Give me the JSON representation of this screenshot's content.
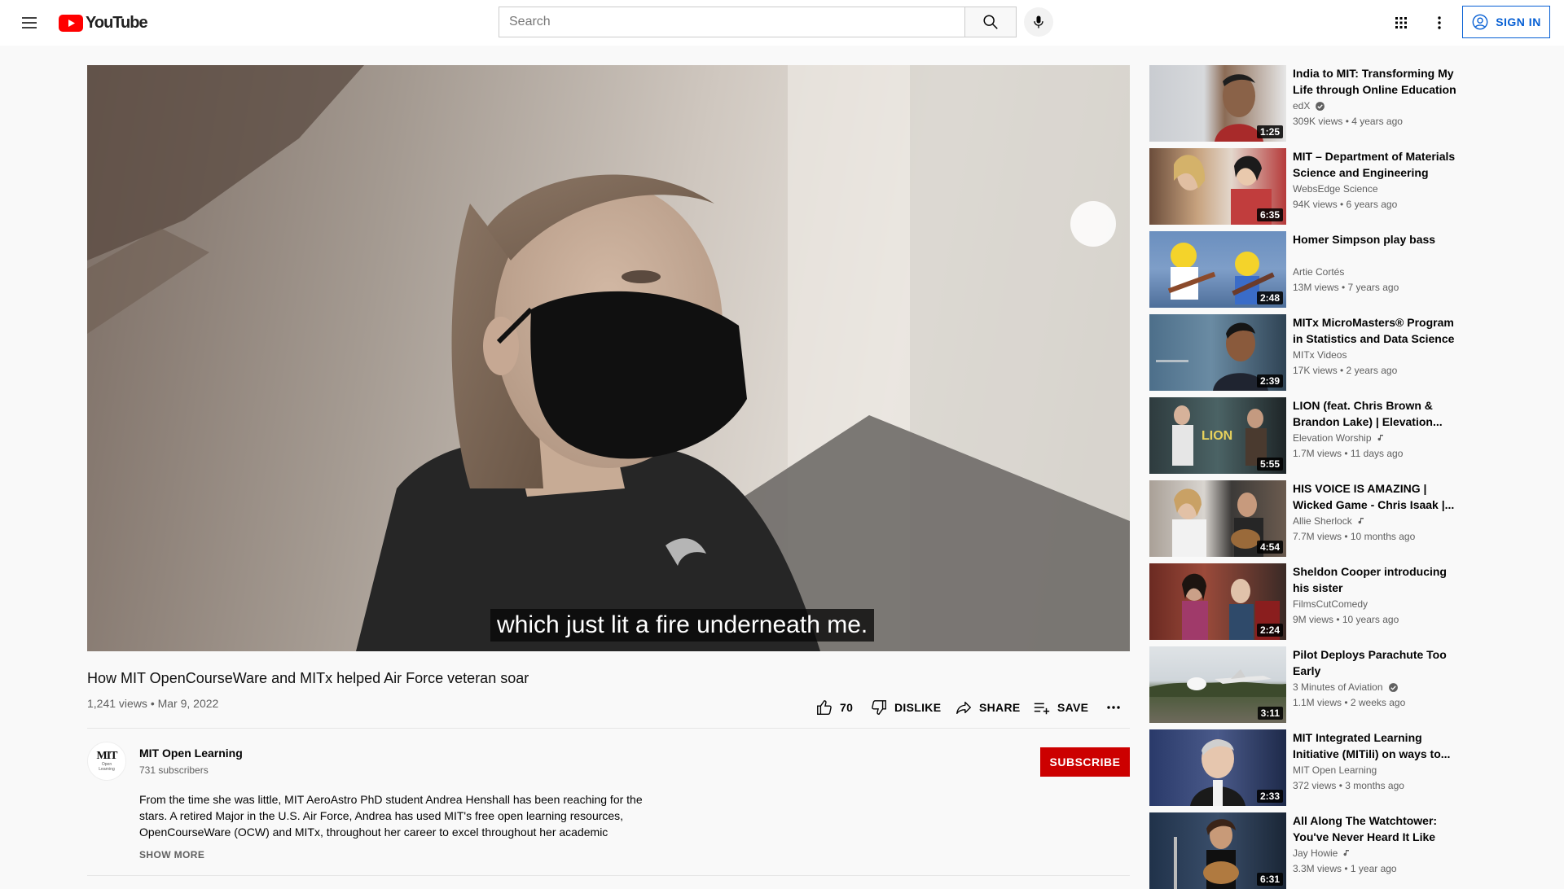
{
  "header": {
    "logo_text": "YouTube",
    "search_placeholder": "Search",
    "signin_label": "SIGN IN"
  },
  "player": {
    "caption": "which just lit a fire underneath me."
  },
  "video": {
    "title": "How MIT OpenCourseWare and MITx helped Air Force veteran soar",
    "meta": "1,241 views • Mar 9, 2022",
    "likes": "70",
    "dislike_label": "DISLIKE",
    "share_label": "SHARE",
    "save_label": "SAVE"
  },
  "channel": {
    "name": "MIT Open Learning",
    "subscribers": "731 subscribers",
    "subscribe_label": "SUBSCRIBE",
    "avatar_text": "MIT",
    "avatar_sub": "Open Learning"
  },
  "description": {
    "text": "From the time she was little, MIT AeroAstro PhD student Andrea Henshall has been reaching for the stars. A retired Major in the U.S. Air Force, Andrea has used MIT's free open learning resources, OpenCourseWare (OCW) and MITx, throughout her career to excel throughout her academic",
    "show_more": "SHOW MORE"
  },
  "recommendations": [
    {
      "title": "India to MIT: Transforming My Life through Online Education ...",
      "channel": "edX",
      "badge": "verified",
      "stats": "309K views • 4 years ago",
      "duration": "1:25"
    },
    {
      "title": "MIT – Department of Materials Science and Engineering",
      "channel": "WebsEdge Science",
      "badge": "",
      "stats": "94K views • 6 years ago",
      "duration": "6:35"
    },
    {
      "title": "Homer Simpson play bass",
      "channel": "Artie Cortés",
      "badge": "",
      "stats": "13M views • 7 years ago",
      "duration": "2:48"
    },
    {
      "title": "MITx MicroMasters® Program in Statistics and Data Science ...",
      "channel": "MITx Videos",
      "badge": "",
      "stats": "17K views • 2 years ago",
      "duration": "2:39"
    },
    {
      "title": "LION (feat. Chris Brown & Brandon Lake) | Elevation...",
      "channel": "Elevation Worship",
      "badge": "music",
      "stats": "1.7M views • 11 days ago",
      "duration": "5:55"
    },
    {
      "title": "HIS VOICE IS AMAZING | Wicked Game - Chris Isaak |...",
      "channel": "Allie Sherlock",
      "badge": "music",
      "stats": "7.7M views • 10 months ago",
      "duration": "4:54"
    },
    {
      "title": "Sheldon Cooper introducing his sister",
      "channel": "FilmsCutComedy",
      "badge": "",
      "stats": "9M views • 10 years ago",
      "duration": "2:24"
    },
    {
      "title": "Pilot Deploys Parachute Too Early",
      "channel": "3 Minutes of Aviation",
      "badge": "verified",
      "stats": "1.1M views • 2 weeks ago",
      "duration": "3:11"
    },
    {
      "title": "MIT Integrated Learning Initiative (MITili) on ways to...",
      "channel": "MIT Open Learning",
      "badge": "",
      "stats": "372 views • 3 months ago",
      "duration": "2:33"
    },
    {
      "title": "All Along The Watchtower: You've Never Heard It Like Thi...",
      "channel": "Jay Howie",
      "badge": "music",
      "stats": "3.3M views • 1 year ago",
      "duration": "6:31"
    }
  ]
}
